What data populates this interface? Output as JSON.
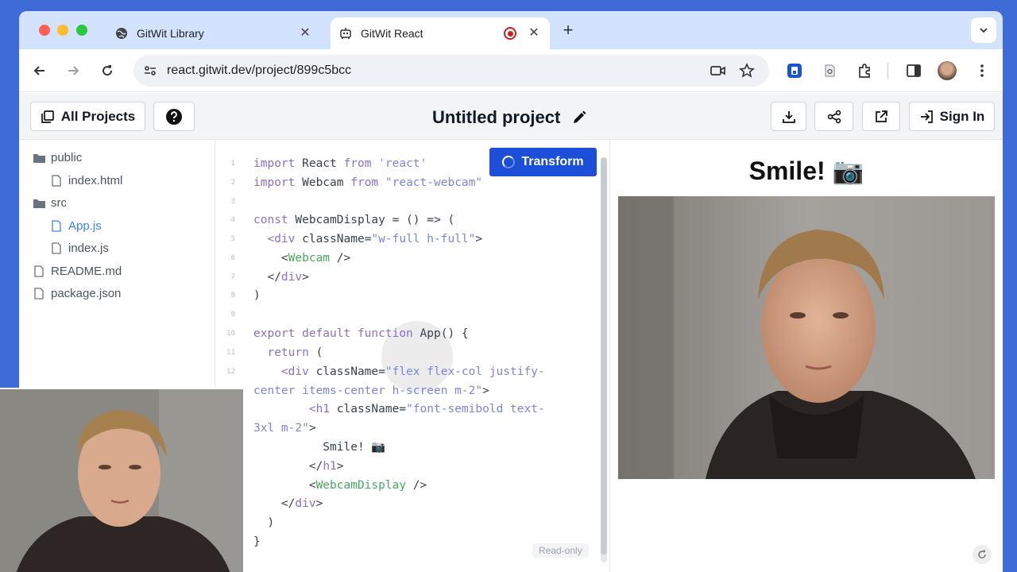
{
  "browser": {
    "tabs": [
      {
        "title": "GitWit Library",
        "icon": "globe-icon"
      },
      {
        "title": "GitWit React",
        "icon": "robot-icon",
        "recording": true
      }
    ],
    "address": "react.gitwit.dev/project/899c5bcc"
  },
  "app": {
    "all_projects_label": "All Projects",
    "project_title": "Untitled project",
    "sign_in_label": "Sign In"
  },
  "files": [
    {
      "name": "public",
      "type": "folder"
    },
    {
      "name": "index.html",
      "type": "file"
    },
    {
      "name": "src",
      "type": "folder"
    },
    {
      "name": "App.js",
      "type": "file",
      "active": true
    },
    {
      "name": "index.js",
      "type": "file"
    },
    {
      "name": "README.md",
      "type": "file"
    },
    {
      "name": "package.json",
      "type": "file"
    }
  ],
  "editor": {
    "transform_label": "Transform",
    "readonly_label": "Read-only",
    "line_numbers": [
      "1",
      "2",
      "3",
      "4",
      "5",
      "6",
      "7",
      "8",
      "9",
      "10",
      "11",
      "12"
    ],
    "lines": [
      "import React from 'react'",
      "import Webcam from \"react-webcam\"",
      "",
      "const WebcamDisplay = () => (",
      "  <div className=\"w-full h-full\">",
      "    <Webcam />",
      "  </div>",
      ")",
      "",
      "export default function App() {",
      "  return (",
      "    <div className=\"flex flex-col justify-",
      "center items-center h-screen m-2\">",
      "        <h1 className=\"font-semibold text-",
      "3xl m-2\">",
      "          Smile! 📷",
      "        </h1>",
      "        <WebcamDisplay />",
      "    </div>",
      "  )",
      "}"
    ]
  },
  "preview": {
    "title": "Smile! 📷"
  }
}
